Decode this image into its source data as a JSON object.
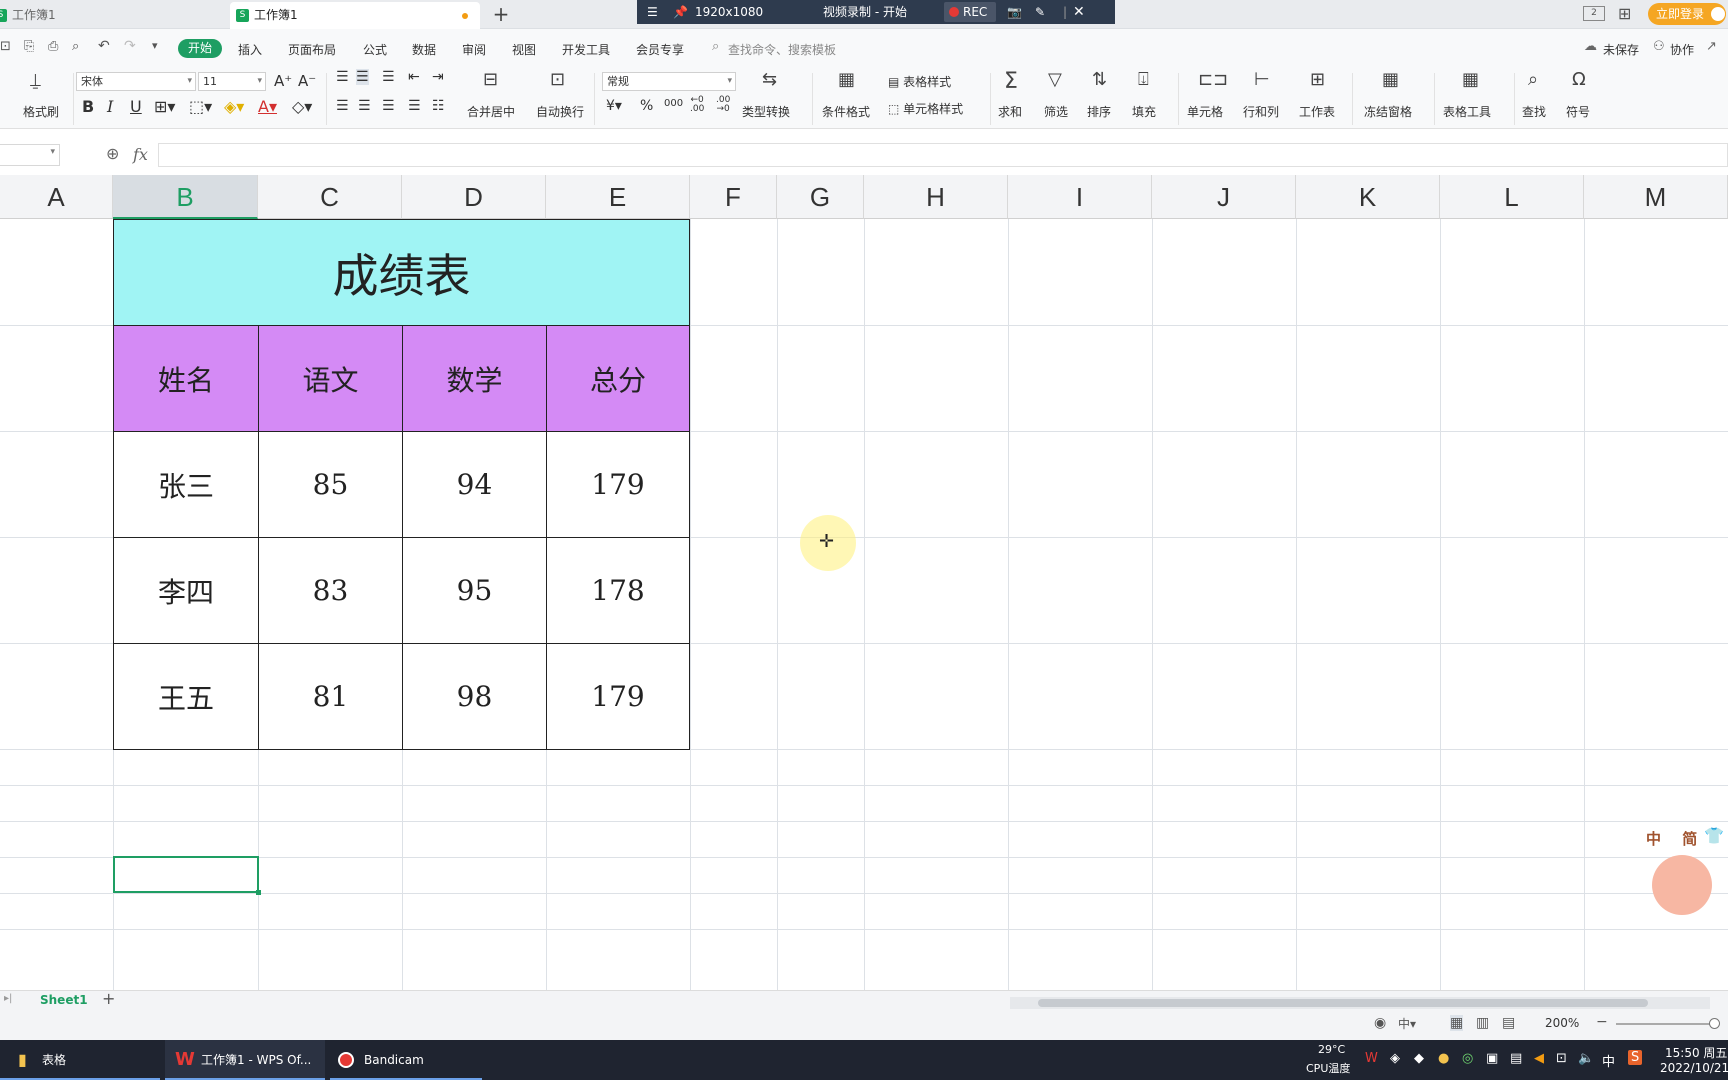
{
  "tabs": {
    "tab1": "工作簿1",
    "tab2": "工作簿1",
    "new": "+"
  },
  "recorder": {
    "menu": "☰",
    "resolution": "1920x1080",
    "title": "视频录制 - 开始",
    "rec": "REC"
  },
  "top_right": {
    "login": "立即登录"
  },
  "menu": {
    "home": "开始",
    "insert": "插入",
    "page_layout": "页面布局",
    "formula": "公式",
    "data": "数据",
    "review": "审阅",
    "view": "视图",
    "dev_tools": "开发工具",
    "member": "会员专享",
    "search_placeholder": "查找命令、搜索模板",
    "unsaved": "未保存",
    "collab": "协作"
  },
  "ribbon": {
    "format_painter": "格式刷",
    "font_name": "宋体",
    "font_size": "11",
    "merge_center": "合并居中",
    "auto_wrap": "自动换行",
    "number_format": "常规",
    "type_convert": "类型转换",
    "cond_format": "条件格式",
    "table_style": "表格样式",
    "cell_style": "单元格样式",
    "sum": "求和",
    "filter": "筛选",
    "sort": "排序",
    "fill": "填充",
    "cell": "单元格",
    "row_col": "行和列",
    "worksheet": "工作表",
    "freeze": "冻结窗格",
    "table_tools": "表格工具",
    "find": "查找",
    "symbol": "符号",
    "bold": "B",
    "italic": "I",
    "underline": "U",
    "percent": "%",
    "thousands": "000",
    "currency": "¥"
  },
  "formula_bar": {
    "fx": "fx",
    "content": ""
  },
  "columns": [
    "A",
    "B",
    "C",
    "D",
    "E",
    "F",
    "G",
    "H",
    "I",
    "J",
    "K",
    "L",
    "M"
  ],
  "table": {
    "title": "成绩表",
    "headers": [
      "姓名",
      "语文",
      "数学",
      "总分"
    ],
    "rows": [
      [
        "张三",
        "85",
        "94",
        "179"
      ],
      [
        "李四",
        "83",
        "95",
        "178"
      ],
      [
        "王五",
        "81",
        "98",
        "179"
      ]
    ]
  },
  "sheet_tabs": {
    "active": "Sheet1",
    "add": "+"
  },
  "status": {
    "zoom": "200%"
  },
  "watermark": {
    "text": "中 简"
  },
  "taskbar": {
    "item1": "表格",
    "item2": "工作簿1 - WPS Of...",
    "item3": "Bandicam",
    "temp": "29°C",
    "cpu": "CPU温度",
    "ime": "中",
    "time": "15:50 周五",
    "date": "2022/10/21"
  },
  "colors": {
    "title_bg": "#a0f4f4",
    "header_bg": "#d48af5",
    "accent": "#1e9e63"
  }
}
